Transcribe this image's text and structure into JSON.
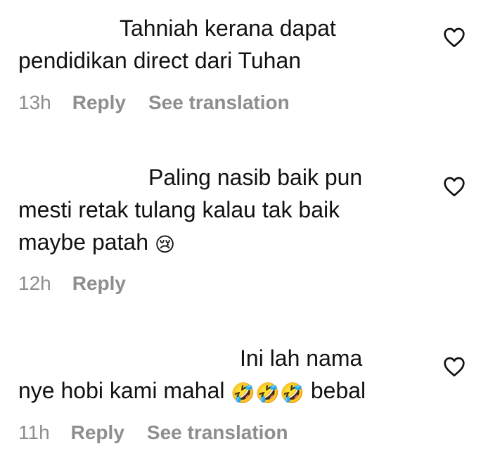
{
  "comments": [
    {
      "line1": "Tahniah kerana dapat",
      "line2": "pendidikan direct dari Tuhan",
      "time": "13h",
      "reply": "Reply",
      "translate": "See translation"
    },
    {
      "line1": "Paling nasib baik pun",
      "line2": "mesti retak tulang kalau tak baik",
      "line3": "maybe patah",
      "emoji": "😢",
      "time": "12h",
      "reply": "Reply"
    },
    {
      "line1": "Ini lah nama",
      "line2_pre": "nye hobi kami mahal",
      "emoji": "🤣🤣🤣",
      "line2_post": "bebal",
      "time": "11h",
      "reply": "Reply",
      "translate": "See translation"
    }
  ],
  "icons": {
    "like": "heart-outline-icon",
    "cry": "crying-face-emoji",
    "laugh": "rolling-on-floor-laughing-emoji"
  },
  "colors": {
    "text": "#111111",
    "meta": "#8e8e8e"
  }
}
